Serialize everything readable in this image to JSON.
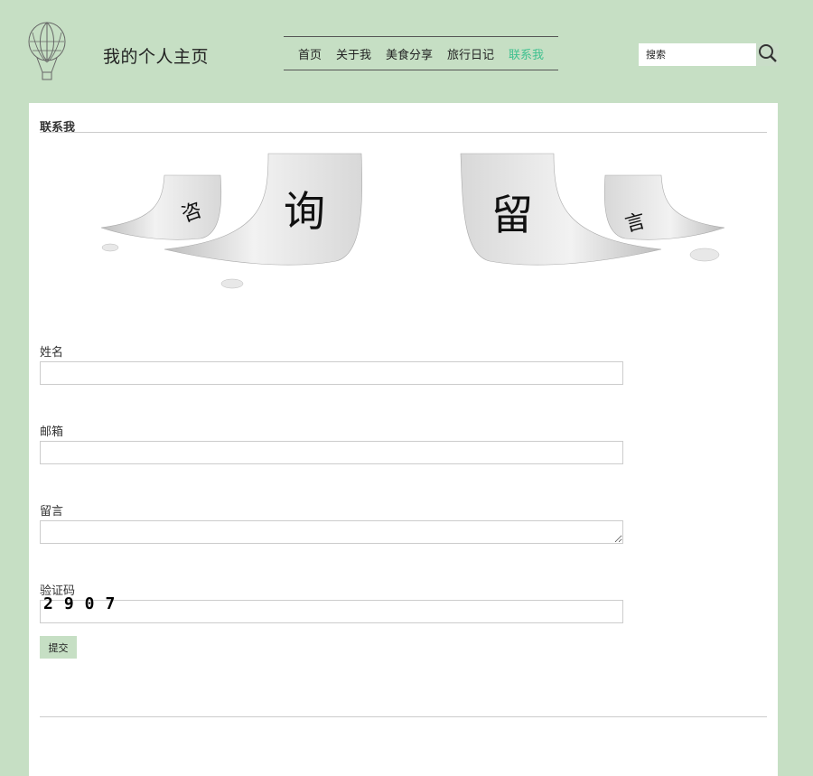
{
  "header": {
    "site_title": "我的个人主页",
    "nav": [
      {
        "label": "首页"
      },
      {
        "label": "关于我"
      },
      {
        "label": "美食分享"
      },
      {
        "label": "旅行日记"
      },
      {
        "label": "联系我",
        "active": true
      }
    ],
    "search": {
      "placeholder": "搜索"
    }
  },
  "main": {
    "section_title": "联系我",
    "banner": {
      "chars": [
        "咨",
        "询",
        "留",
        "言"
      ]
    },
    "form": {
      "name_label": "姓名",
      "email_label": "邮箱",
      "message_label": "留言",
      "captcha_label": "验证码",
      "captcha_value": "2907",
      "submit_label": "提交"
    }
  },
  "colors": {
    "background": "#c6dfc4",
    "active_nav": "#3ec08f",
    "panel": "#ffffff"
  }
}
